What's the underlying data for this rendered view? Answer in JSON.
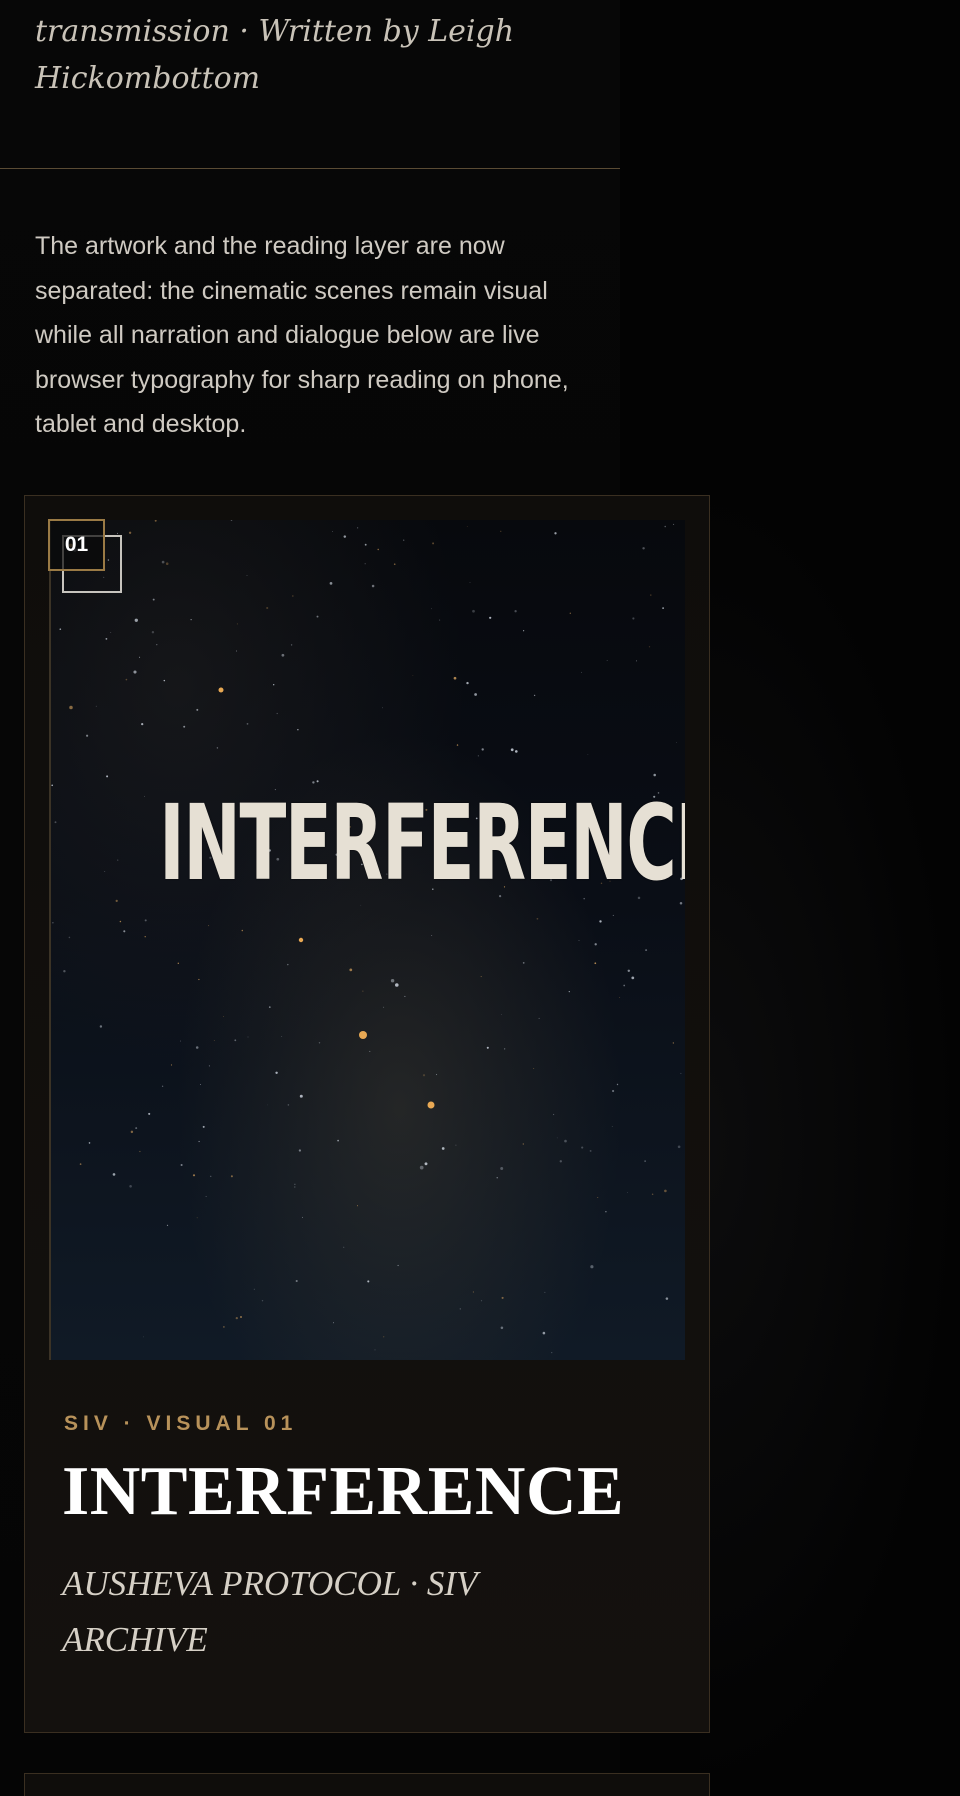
{
  "header": {
    "byline_line1": "transmission · Written by Leigh",
    "byline_line2": "Hickombottom"
  },
  "intro": {
    "text": "The artwork and the reading layer are now separated: the cinematic scenes remain visual while all narration and dialogue below are live browser typography for sharp reading on phone, tablet and desktop."
  },
  "card": {
    "badge": "01",
    "art_title": "INTERFERENCE",
    "eyebrow": "SIV · VISUAL 01",
    "title": "INTERFERENCE",
    "subtitle": "AUSHEVA PROTOCOL · SIV ARCHIVE"
  },
  "colors": {
    "background": "#030303",
    "accent_gold": "#b8925a",
    "card_border": "#3a2f21",
    "text": "#cfcac2"
  }
}
